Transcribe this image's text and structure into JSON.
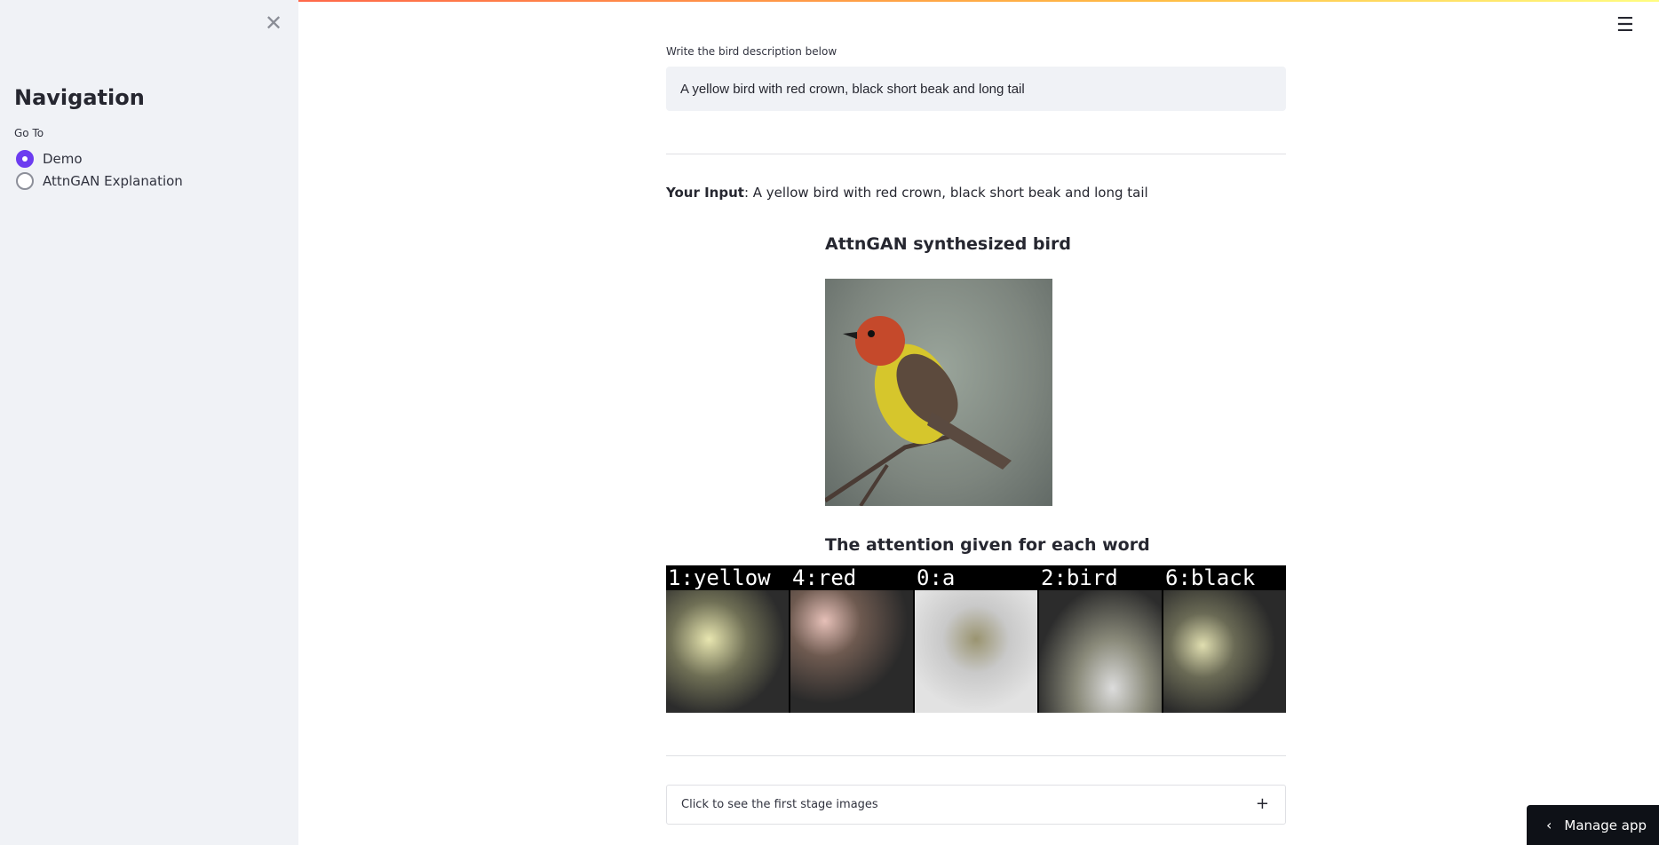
{
  "sidebar": {
    "close_icon": "close-icon",
    "title": "Navigation",
    "goto_label": "Go To",
    "options": [
      {
        "label": "Demo",
        "selected": true
      },
      {
        "label": "AttnGAN Explanation",
        "selected": false
      }
    ]
  },
  "header": {
    "menu_icon": "hamburger-icon",
    "accent": "#ff4b4b"
  },
  "main": {
    "input_label": "Write the bird description below",
    "input_value": "A yellow bird with red crown, black short beak and long tail",
    "your_input_label": "Your Input",
    "your_input_text": ": A yellow bird with red crown, black short beak and long tail",
    "synth_heading": "AttnGAN synthesized bird",
    "attention_heading": "The attention given for each word",
    "attention_words": [
      "1:yellow",
      "4:red",
      "0:a",
      "2:bird",
      "6:black"
    ],
    "expander_label": "Click to see the first stage images"
  },
  "footer": {
    "manage_label": "Manage app",
    "radio_accent": "#6c3cf0"
  }
}
